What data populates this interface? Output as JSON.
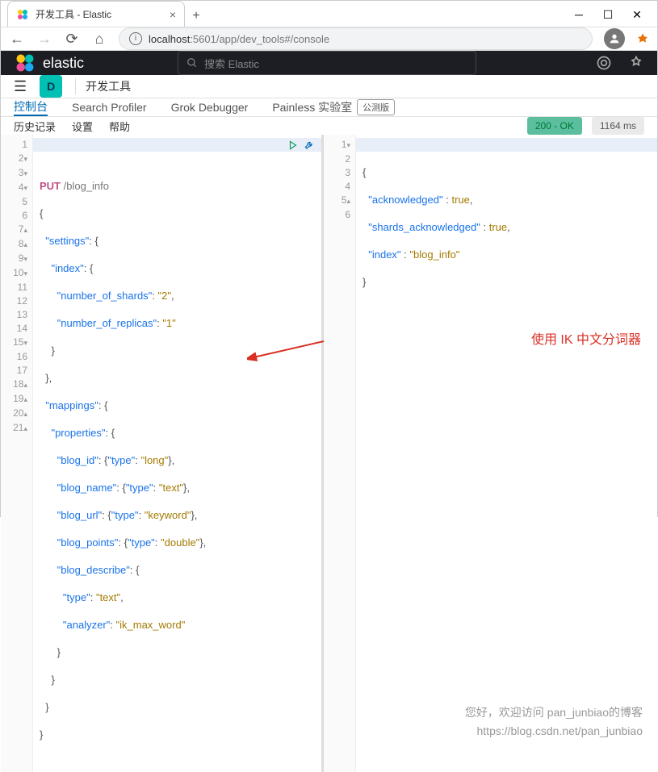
{
  "browser": {
    "tab_title": "开发工具 - Elastic",
    "url_host": "localhost",
    "url_path": ":5601/app/dev_tools#/console"
  },
  "elastic_header": {
    "brand": "elastic",
    "search_placeholder": "搜索 Elastic"
  },
  "app_bar": {
    "badge": "D",
    "name": "开发工具"
  },
  "dev_tabs": {
    "console": "控制台",
    "profiler": "Search Profiler",
    "grok": "Grok Debugger",
    "painless": "Painless 实验室",
    "beta": "公测版"
  },
  "sub_bar": {
    "history": "历史记录",
    "settings": "设置",
    "help": "帮助",
    "status": "200 - OK",
    "time": "1164 ms"
  },
  "editor": {
    "lines": [
      "1",
      "2",
      "3",
      "4",
      "5",
      "6",
      "7",
      "8",
      "9",
      "10",
      "11",
      "12",
      "13",
      "14",
      "15",
      "16",
      "17",
      "18",
      "19",
      "20",
      "21"
    ],
    "method": "PUT",
    "endpoint": "/blog_info",
    "l2": "{",
    "settings_key": "\"settings\"",
    "index_key": "\"index\"",
    "shards_key": "\"number_of_shards\"",
    "shards_val": "\"2\"",
    "replicas_key": "\"number_of_replicas\"",
    "replicas_val": "\"1\"",
    "mappings_key": "\"mappings\"",
    "properties_key": "\"properties\"",
    "blog_id": "\"blog_id\"",
    "blog_id_type": "\"long\"",
    "blog_name": "\"blog_name\"",
    "text_type": "\"text\"",
    "blog_url": "\"blog_url\"",
    "kw_type": "\"keyword\"",
    "blog_points": "\"blog_points\"",
    "dbl_type": "\"double\"",
    "blog_describe": "\"blog_describe\"",
    "type_key": "\"type\"",
    "analyzer_key": "\"analyzer\"",
    "analyzer_val": "\"ik_max_word\""
  },
  "output": {
    "lines": [
      "1",
      "2",
      "3",
      "4",
      "5",
      "6"
    ],
    "ack": "\"acknowledged\"",
    "shards_ack": "\"shards_acknowledged\"",
    "index_k": "\"index\"",
    "index_v": "\"blog_info\"",
    "true_v": "true"
  },
  "annotation": {
    "text": "使用 IK 中文分词器"
  },
  "watermark": {
    "line1": "您好，欢迎访问 pan_junbiao的博客",
    "line2": "https://blog.csdn.net/pan_junbiao"
  }
}
